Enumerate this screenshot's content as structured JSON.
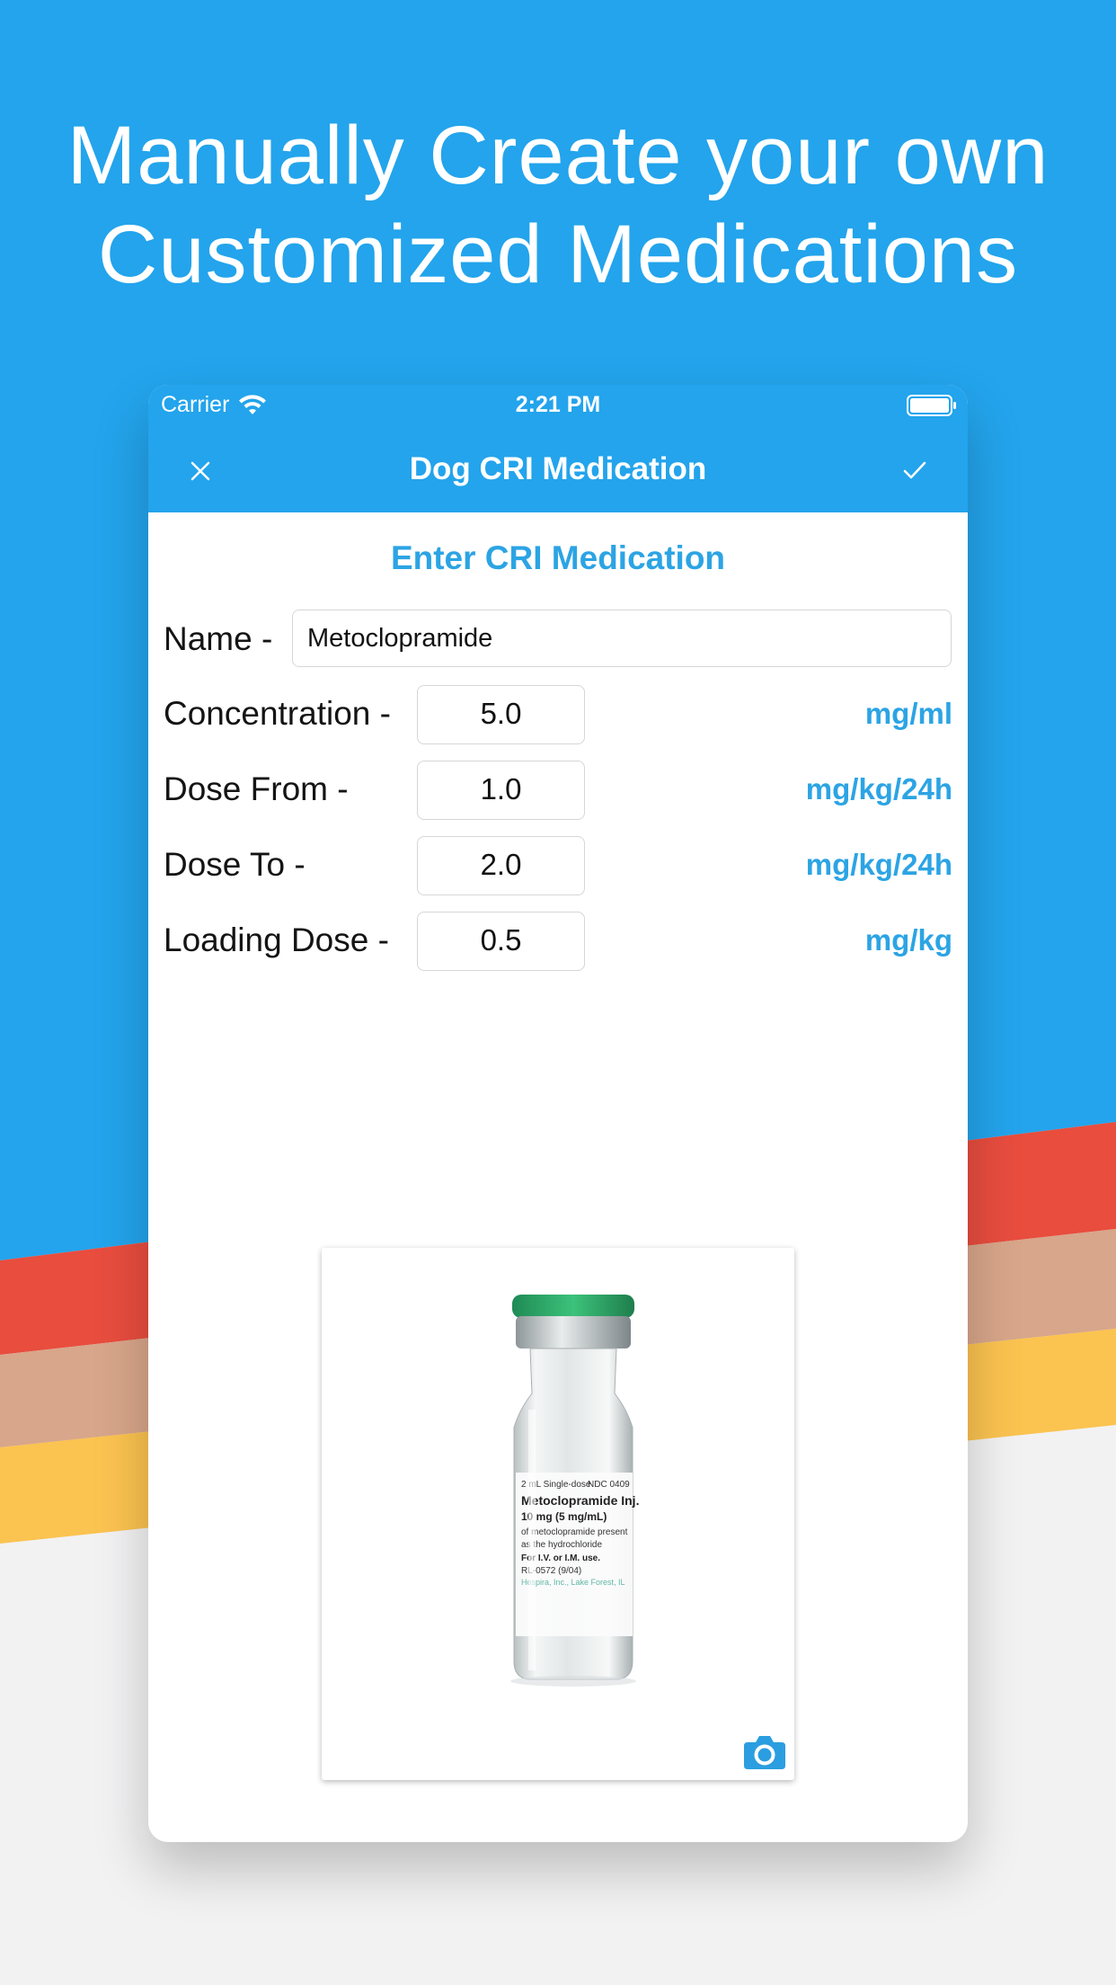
{
  "headline": {
    "line1": "Manually Create your own",
    "line2": "Customized Medications"
  },
  "colors": {
    "brand_blue": "#23a4ec",
    "accent_text": "#2ca4e4",
    "stripe_red": "#e84d3e",
    "stripe_tan": "#d8a68a",
    "stripe_yellow": "#fbc350"
  },
  "status_bar": {
    "carrier": "Carrier",
    "time": "2:21 PM"
  },
  "nav": {
    "title": "Dog CRI Medication",
    "close_icon": "close-icon",
    "confirm_icon": "checkmark-icon"
  },
  "form": {
    "title": "Enter CRI Medication",
    "name_label": "Name -",
    "name_value": "Metoclopramide",
    "fields": [
      {
        "label": "Concentration -",
        "value": "5.0",
        "unit": "mg/ml"
      },
      {
        "label": "Dose From -",
        "value": "1.0",
        "unit": "mg/kg/24h"
      },
      {
        "label": "Dose To -",
        "value": "2.0",
        "unit": "mg/kg/24h"
      },
      {
        "label": "Loading Dose -",
        "value": "0.5",
        "unit": "mg/kg"
      }
    ]
  },
  "vial_label": {
    "line1": "2 mL Single-dose",
    "ndc": "NDC 0409",
    "name": "Metoclopramide Inj.",
    "strength": "10 mg (5 mg/mL)",
    "desc1": "of metoclopramide present",
    "desc2": "as the hydrochloride",
    "route": "For I.V. or I.M. use.",
    "code": "RL-0572 (9/04)",
    "maker": "Hospira, Inc., Lake Forest, IL"
  },
  "photo": {
    "camera_icon": "camera-icon"
  }
}
